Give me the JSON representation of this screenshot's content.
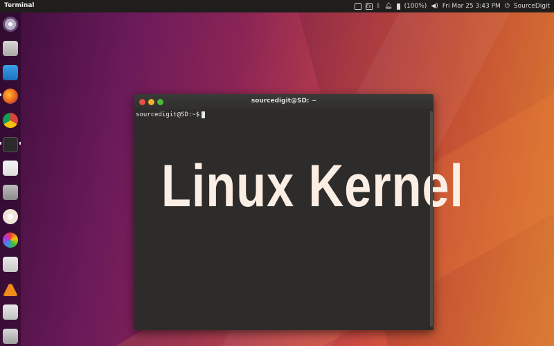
{
  "top_panel": {
    "app_title": "Terminal",
    "battery_text": "(100%)",
    "clock": "Fri Mar 25  3:43 PM",
    "user_name": "SourceDigit",
    "icons": [
      "display-icon",
      "keyboard-icon",
      "bluetooth-icon",
      "notification-bell-icon",
      "battery-icon",
      "volume-icon",
      "power-icon"
    ]
  },
  "launcher": {
    "items": [
      "ubuntu-dash-icon",
      "files-icon",
      "text-editor-icon",
      "firefox-icon",
      "chrome-icon",
      "terminal-icon",
      "document-viewer-icon",
      "disk-utility-icon",
      "color-picker-icon",
      "color-wheel-icon",
      "transfer-icon",
      "vlc-icon",
      "app-icon",
      "software-updater-icon"
    ]
  },
  "terminal": {
    "window_title": "sourcedigit@SD: ~",
    "prompt": "sourcedigit@SD:~$ ",
    "overlay_text": "Linux Kernel"
  },
  "colors": {
    "panel_bg": "#1f1e1c",
    "terminal_bg": "#2d2c2a",
    "close_btn": "#e2523e",
    "minimize_btn": "#f0b32a",
    "maximize_btn": "#4cbb3a",
    "overlay_text": "#fbeee4"
  }
}
